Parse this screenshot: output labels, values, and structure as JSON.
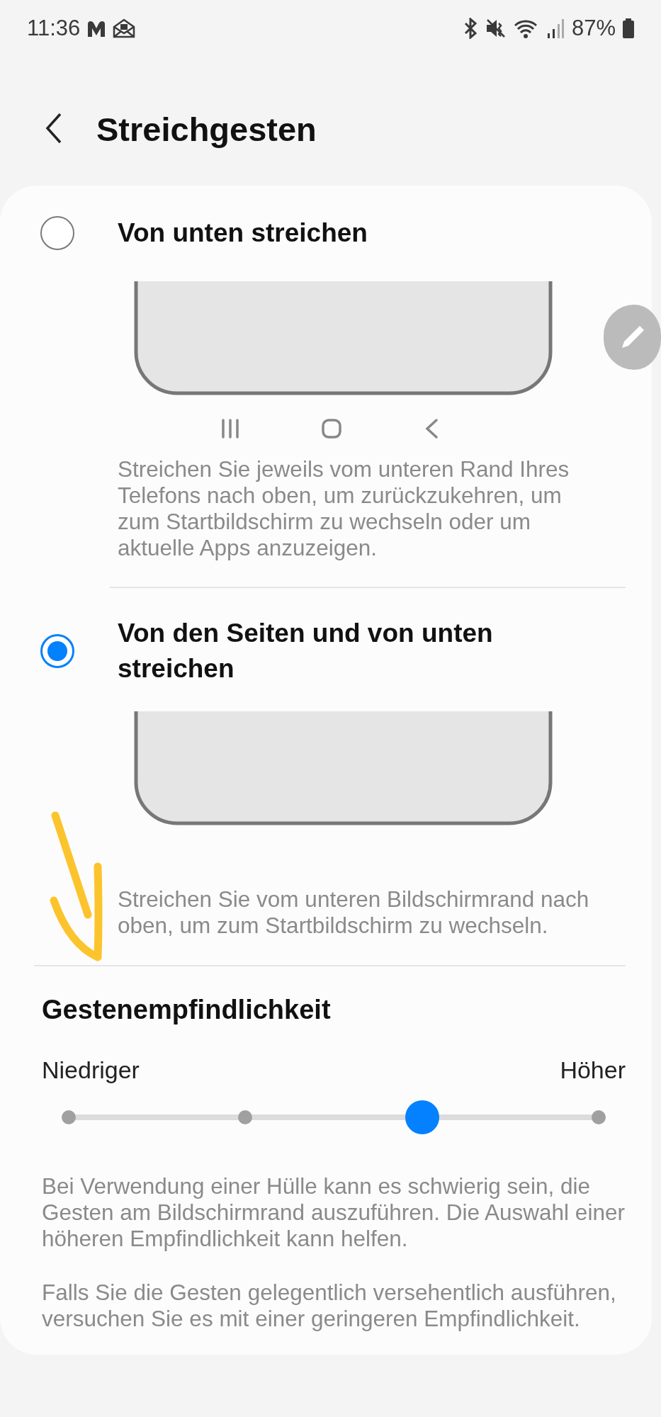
{
  "status_bar": {
    "time": "11:36",
    "battery": "87%"
  },
  "header": {
    "title": "Streichgesten"
  },
  "options": [
    {
      "kind": "buttons",
      "label": "Von unten streichen",
      "selected": false,
      "description": "Streichen Sie jeweils vom unteren Rand Ihres Telefons nach oben, um zurückzukehren, um zum Startbildschirm zu wechseln oder um aktuelle Apps anzuzeigen."
    },
    {
      "kind": "gestures",
      "label": "Von den Seiten und von unten streichen",
      "selected": true,
      "description": "Streichen Sie vom unteren Bildschirmrand nach oben, um zum Startbildschirm zu wechseln."
    }
  ],
  "sensitivity": {
    "title": "Gestenempfindlichkeit",
    "min_label": "Niedriger",
    "max_label": "Höher",
    "level": 0.667,
    "notes": [
      "Bei Verwendung einer Hülle kann es schwierig sein, die Gesten am Bildschirmrand auszuführen. Die Auswahl einer höheren Empfindlichkeit kann helfen.",
      "Falls Sie die Gesten gelegentlich versehentlich ausführen, versuchen Sie es mit einer geringeren Empfindlichkeit."
    ]
  }
}
